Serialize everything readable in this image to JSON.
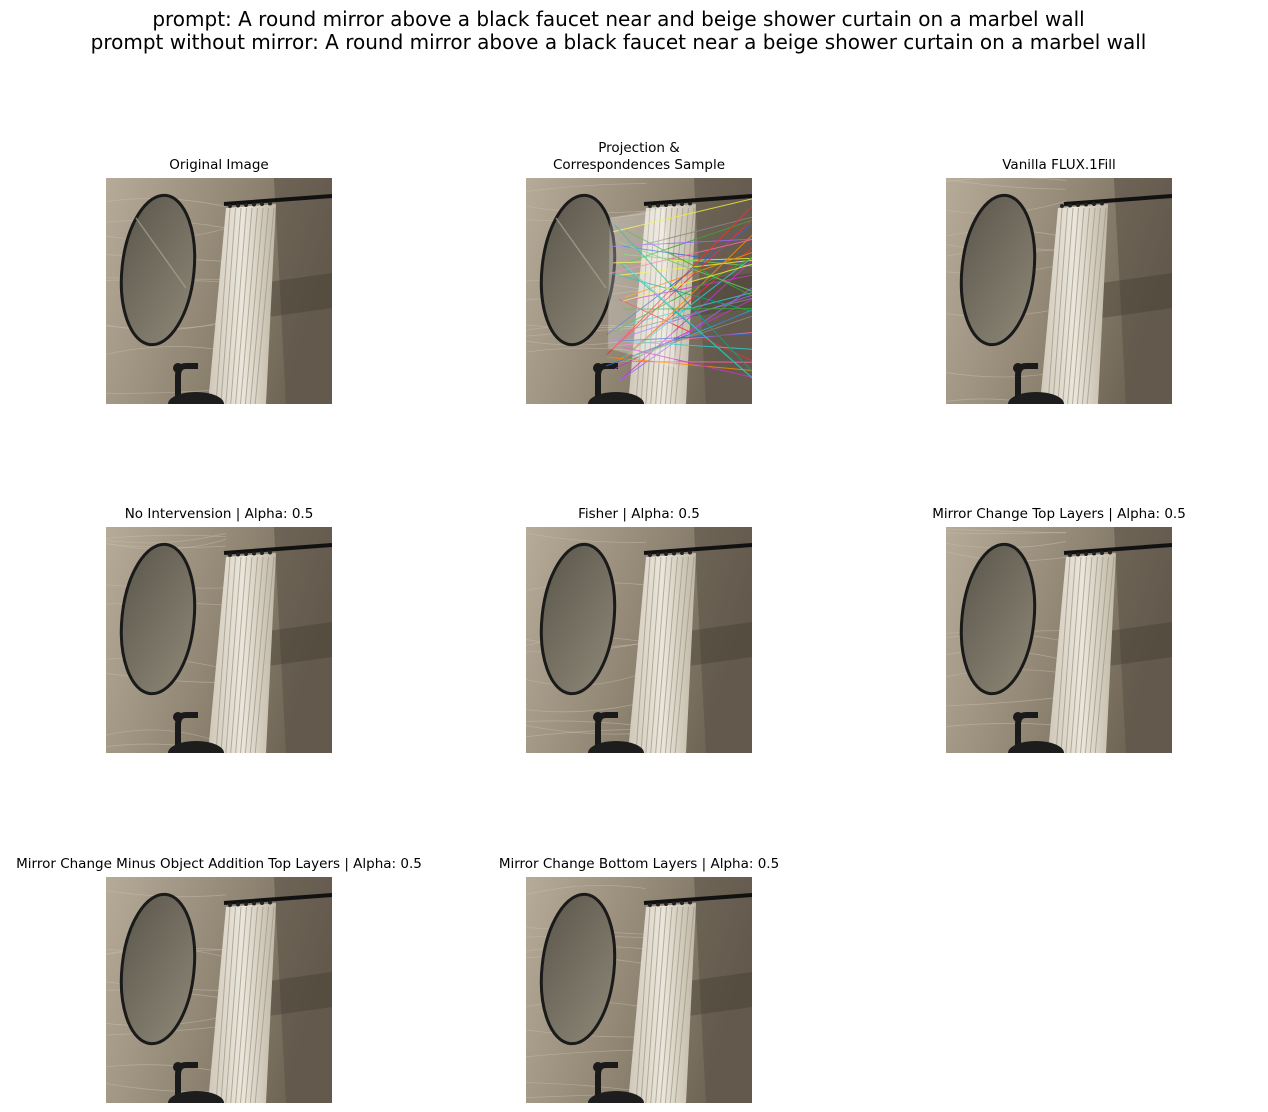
{
  "suptitle": {
    "line1": "prompt: A round mirror above a black faucet near and beige shower curtain on a marbel wall",
    "line2": "prompt without mirror: A round mirror above a black faucet near a beige shower curtain on a marbel wall"
  },
  "panels": [
    {
      "title": "Original Image",
      "variant": "original"
    },
    {
      "title_line1": "Projection &",
      "title_line2": "Correspondences Sample",
      "variant": "correspondences"
    },
    {
      "title": "Vanilla FLUX.1Fill",
      "variant": "vanilla"
    },
    {
      "title": "No Intervension | Alpha: 0.5",
      "variant": "no-intervention"
    },
    {
      "title": "Fisher | Alpha: 0.5",
      "variant": "fisher"
    },
    {
      "title": "Mirror Change Top Layers | Alpha: 0.5",
      "variant": "top-layers"
    },
    {
      "title": "Mirror Change Minus Object Addition Top Layers | Alpha: 0.5",
      "variant": "minus-object"
    },
    {
      "title": "Mirror Change Bottom Layers | Alpha: 0.5",
      "variant": "bottom-layers"
    }
  ],
  "colors": {
    "wall": "#9a8f7e",
    "wall_dark": "#5a5145",
    "curtain": "#d9d3c6",
    "mirror_frame": "#1a1a1a"
  }
}
